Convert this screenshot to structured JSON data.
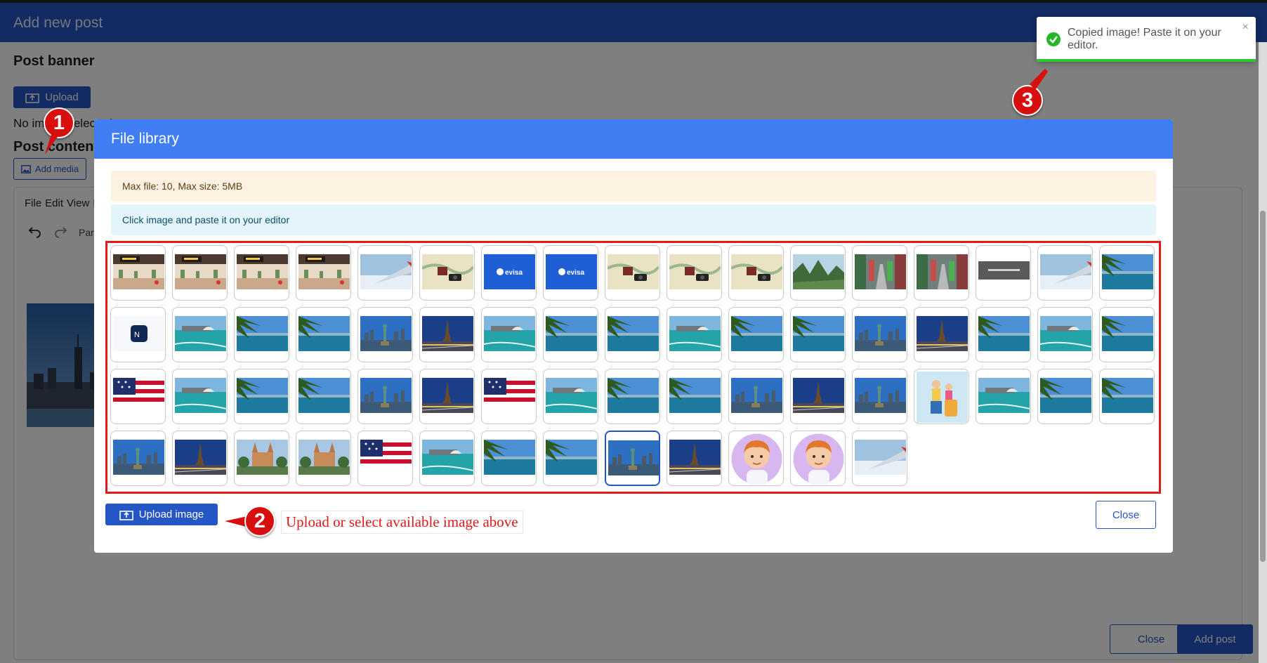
{
  "header": {
    "title": "Add new post"
  },
  "page": {
    "post_banner_heading": "Post banner",
    "upload_label": "Upload",
    "no_image_text": "No image selected",
    "post_content_heading": "Post content",
    "add_media_label": "Add media",
    "menu": [
      "File",
      "Edit",
      "View",
      "In"
    ],
    "paragraph_label": "Para",
    "footer_close_label": "Close",
    "add_post_label": "Add post"
  },
  "modal": {
    "title": "File library",
    "limits_text": "Max file: 10, Max size: 5MB",
    "instruction_text": "Click image and paste it on your editor",
    "upload_image_label": "Upload image",
    "close_label": "Close",
    "evisa_label": "evisa",
    "images": [
      "airport-hall",
      "airport-hall",
      "airport-hall",
      "airport-hall",
      "plane-wing",
      "map-camera",
      "evisa-logo",
      "evisa-logo",
      "map-camera",
      "map-camera",
      "map-camera",
      "mountain-valley",
      "street-market",
      "street-market",
      "dark-banner",
      "plane-wing",
      "palm-coast",
      "site-logo",
      "sydney-bay",
      "palm-coast",
      "palm-coast",
      "liberty-skyline",
      "eiffel-tower",
      "sydney-bay",
      "palm-coast",
      "palm-coast",
      "sydney-bay",
      "palm-coast",
      "palm-coast",
      "liberty-skyline",
      "eiffel-tower",
      "palm-coast",
      "sydney-bay",
      "palm-coast",
      "us-flag",
      "sydney-bay",
      "palm-coast",
      "palm-coast",
      "liberty-skyline",
      "eiffel-tower",
      "us-flag",
      "sydney-bay",
      "palm-coast",
      "palm-coast",
      "liberty-skyline",
      "eiffel-tower",
      "liberty-skyline",
      "traveler-luggage",
      "sydney-bay",
      "palm-coast",
      "palm-coast",
      "liberty-skyline",
      "eiffel-tower",
      "cathedral",
      "cathedral",
      "us-flag",
      "sydney-bay",
      "palm-coast",
      "palm-coast",
      "liberty-skyline",
      "eiffel-tower",
      "avatar-boy",
      "avatar-boy",
      "plane-wing"
    ],
    "selected_index": 59
  },
  "annotations": {
    "step1": "1",
    "step2": "2",
    "step3": "3",
    "step2_text": "Upload or select available image above"
  },
  "toast": {
    "message": "Copied image! Paste it on your editor.",
    "close_glyph": "×"
  },
  "colors": {
    "primary": "#2457c5",
    "modal_header": "#3f7ef3",
    "annotation_red": "#e01b1b",
    "success": "#2bc92b"
  }
}
